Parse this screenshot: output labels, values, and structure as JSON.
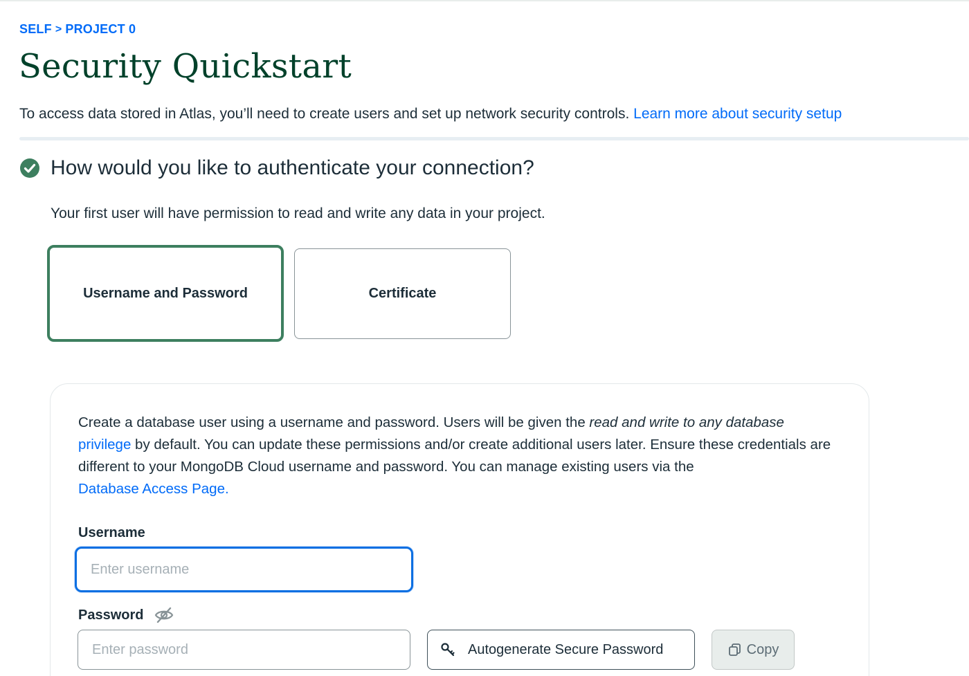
{
  "breadcrumb": {
    "org": "SELF",
    "separator": ">",
    "project": "PROJECT 0"
  },
  "page_title": "Security Quickstart",
  "intro": {
    "text": "To access data stored in Atlas, you’ll need to create users and set up network security controls. ",
    "link": "Learn more about security setup"
  },
  "auth_section": {
    "status_icon": "check-circle-icon",
    "heading": "How would you like to authenticate your connection?",
    "subtitle": "Your first user will have permission to read and write any data in your project.",
    "options": [
      {
        "label": "Username and Password",
        "selected": true
      },
      {
        "label": "Certificate",
        "selected": false
      }
    ]
  },
  "user_form": {
    "description": {
      "part1": "Create a database user using a username and password. Users will be given the ",
      "italic": "read and write to any database",
      "link1": "privilege",
      "part2": " by default. You can update these permissions and/or create additional users later. Ensure these credentials are different to your MongoDB Cloud username and password. You can manage existing users via the ",
      "link2": "Database Access Page."
    },
    "username": {
      "label": "Username",
      "placeholder": "Enter username",
      "value": ""
    },
    "password": {
      "label": "Password",
      "placeholder": "Enter password",
      "value": "",
      "visibility_icon": "eye-slash-icon"
    },
    "autogenerate_button": {
      "icon": "key-icon",
      "label": "Autogenerate Secure Password"
    },
    "copy_button": {
      "icon": "copy-icon",
      "label": "Copy"
    }
  },
  "colors": {
    "link": "#016bf8",
    "title": "#00412a",
    "selected_border": "#3d7f5f",
    "focus_border": "#0c6fe2",
    "check_green": "#3d7f5f"
  }
}
